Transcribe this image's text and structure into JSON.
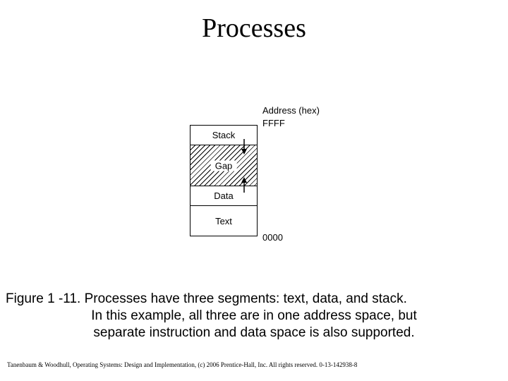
{
  "title": "Processes",
  "diagram": {
    "address_label": "Address (hex)",
    "address_top": "FFFF",
    "address_bottom": "0000",
    "segments": {
      "stack": "Stack",
      "gap": "Gap",
      "data": "Data",
      "text": "Text"
    }
  },
  "caption": {
    "line1": "Figure 1 -11. Processes have three segments: text, data, and stack.",
    "line2": "In this example, all three are in one address space, but",
    "line3": "separate instruction and data space is also supported."
  },
  "copyright": "Tanenbaum & Woodhull, Operating Systems: Design and Implementation, (c) 2006 Prentice-Hall, Inc. All rights reserved. 0-13-142938-8"
}
